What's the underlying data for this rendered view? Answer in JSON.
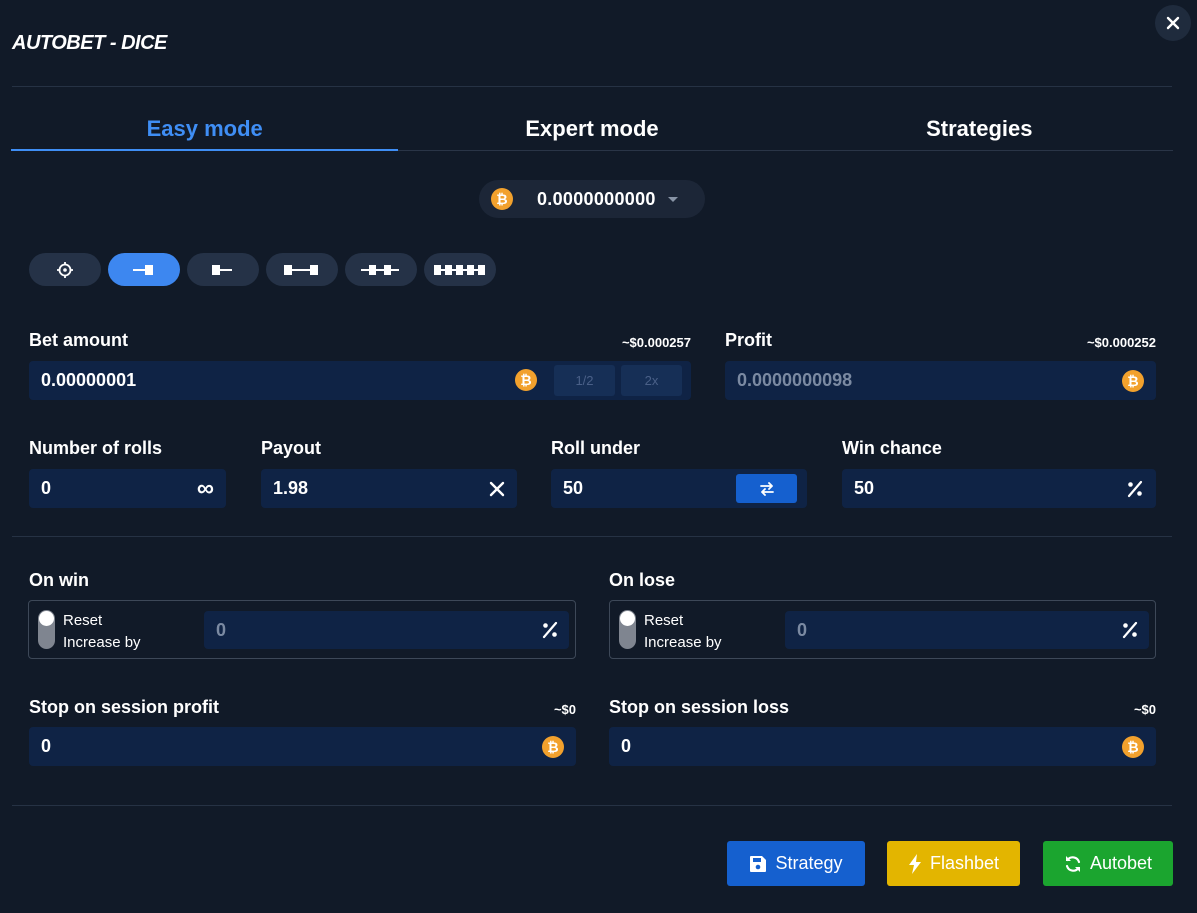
{
  "header": {
    "title": "AUTOBET - DICE"
  },
  "tabs": [
    {
      "label": "Easy mode",
      "active": true
    },
    {
      "label": "Expert mode",
      "active": false
    },
    {
      "label": "Strategies",
      "active": false
    }
  ],
  "currency": {
    "icon": "bitcoin-icon",
    "amount_main": "0.0000000000",
    "amount_small": ""
  },
  "bet_modes": [
    {
      "name": "target",
      "active": false
    },
    {
      "name": "single",
      "active": true
    },
    {
      "name": "left-bar",
      "active": false
    },
    {
      "name": "bars",
      "active": false
    },
    {
      "name": "split",
      "active": false
    },
    {
      "name": "multi",
      "active": false
    }
  ],
  "bet_amount": {
    "label": "Bet amount",
    "usd": "~$0.000257",
    "value": "0.00000001",
    "half_label": "1/2",
    "double_label": "2x"
  },
  "profit": {
    "label": "Profit",
    "usd": "~$0.000252",
    "value": "0.0000000098"
  },
  "rolls": {
    "label": "Number of rolls",
    "value": "0",
    "suffix": "∞"
  },
  "payout": {
    "label": "Payout",
    "value": "1.98"
  },
  "roll_under": {
    "label": "Roll under",
    "value": "50"
  },
  "win_chance": {
    "label": "Win chance",
    "value": "50"
  },
  "on_win": {
    "label": "On win",
    "reset": "Reset",
    "increase": "Increase by",
    "value": "0"
  },
  "on_lose": {
    "label": "On lose",
    "reset": "Reset",
    "increase": "Increase by",
    "value": "0"
  },
  "stop_profit": {
    "label": "Stop on session profit",
    "usd": "~$0",
    "value": "0"
  },
  "stop_loss": {
    "label": "Stop on session loss",
    "usd": "~$0",
    "value": "0"
  },
  "actions": {
    "strategy": {
      "label": "Strategy",
      "color": "#1560cf"
    },
    "flashbet": {
      "label": "Flashbet",
      "color": "#e3b500"
    },
    "autobet": {
      "label": "Autobet",
      "color": "#1ba52f"
    }
  }
}
